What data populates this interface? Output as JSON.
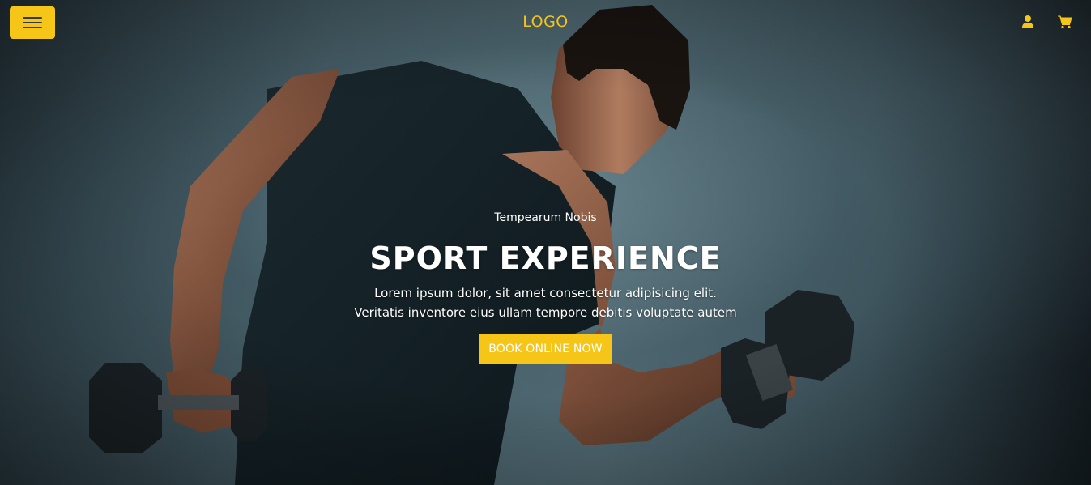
{
  "header": {
    "logo_text": "LOGO",
    "menu_icon": "hamburger-icon",
    "user_icon": "user-icon",
    "cart_icon": "cart-icon"
  },
  "hero": {
    "eyebrow": "Tempearum Nobis",
    "title": "SPORT EXPERIENCE",
    "description_line1": "Lorem ipsum dolor, sit amet consectetur adipisicing elit.",
    "description_line2": "Veritatis inventore eius ullam tempore debitis voluptate autem",
    "cta_label": "BOOK ONLINE NOW"
  },
  "colors": {
    "accent": "#f5c518",
    "text": "#ffffff",
    "background": "#3e545d"
  }
}
